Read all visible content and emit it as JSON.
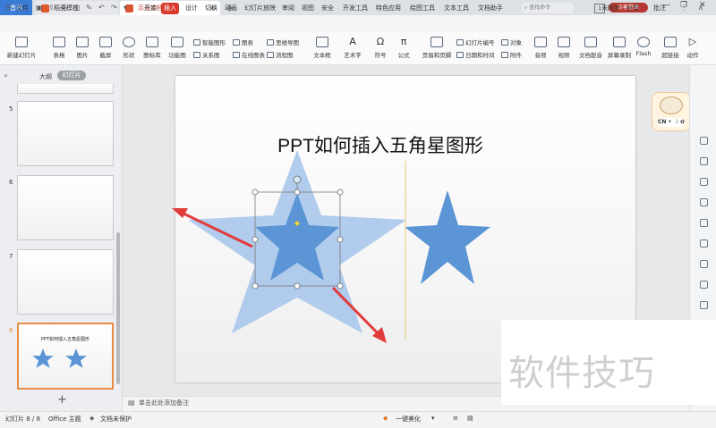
{
  "tabs": {
    "home": "首页",
    "template": "稻壳模板",
    "document": "示范文档.pptx",
    "new_tab": "+"
  },
  "titlebar": {
    "window_count": "1",
    "login": "访客登录",
    "minimize": "—",
    "maximize": "❐",
    "close": "✕"
  },
  "menubar": {
    "file": "文件",
    "items": [
      "开始",
      "插入",
      "设计",
      "切换",
      "动画",
      "幻灯片放映",
      "审阅",
      "视图",
      "安全",
      "开发工具",
      "特色应用",
      "绘图工具",
      "文本工具",
      "文档助手"
    ],
    "search": "查找命令",
    "sync": "未同步",
    "share": "分享",
    "comment": "批注"
  },
  "ribbon": {
    "new_slide": "新建幻灯片",
    "table": "表格",
    "picture": "图片",
    "screenshot": "截屏",
    "shape": "形状",
    "icon_lib": "图标库",
    "function_chart": "功能图",
    "smart_art": "智能图形",
    "chart": "图表",
    "mind_map": "思维导图",
    "relation": "关系图",
    "online_chart": "在线图表",
    "flowchart": "流程图",
    "textbox": "文本框",
    "art_text": "艺术字",
    "symbol": "符号",
    "formula": "公式",
    "header_footer": "页眉和页脚",
    "slide_number": "幻灯片编号",
    "object": "对象",
    "date_time": "日期和时间",
    "attachment": "附件",
    "audio": "音频",
    "video": "视频",
    "doc_voice": "文档配音",
    "screen_record": "屏幕录制",
    "flash": "Flash",
    "hyperlink": "超链接",
    "action": "动作"
  },
  "leftpanel": {
    "outline": "大纲",
    "slides": "幻灯片",
    "numbers": [
      "5",
      "6",
      "7",
      "8"
    ],
    "thumb8_title": "PPT如何插入五角星图形",
    "add": "+"
  },
  "slide": {
    "title": "PPT如何插入五角星图形",
    "star_fill": "#5b95d5",
    "star_ghost_fill": "#a9c6ea",
    "arrow_color": "#e23b3b"
  },
  "notes": {
    "placeholder": "单击此处添加备注"
  },
  "statusbar": {
    "slide_info": "幻灯片 8 / 8",
    "theme": "Office 主题",
    "protect": "文档未保护",
    "beautify": "一键美化"
  },
  "watermark": {
    "text": "软件技巧"
  }
}
